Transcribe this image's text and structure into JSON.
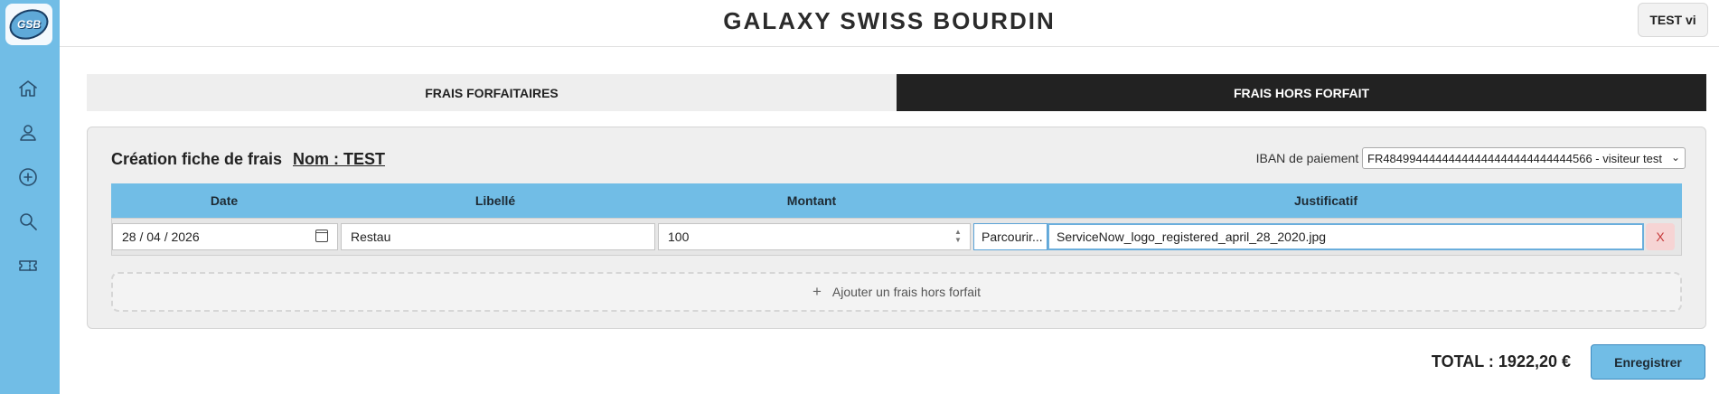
{
  "sidebar": {
    "logo_text": "GSB",
    "items": [
      {
        "icon": "home-icon"
      },
      {
        "icon": "user-icon"
      },
      {
        "icon": "add-circle-icon"
      },
      {
        "icon": "search-icon"
      },
      {
        "icon": "ticket-icon"
      }
    ]
  },
  "header": {
    "title": "GALAXY SWISS BOURDIN",
    "user_label": "TEST vi"
  },
  "tabs": [
    {
      "label": "FRAIS FORFAITAIRES",
      "active": false
    },
    {
      "label": "FRAIS HORS FORFAIT",
      "active": true
    }
  ],
  "form": {
    "title": "Création fiche de frais",
    "name_label": "Nom : TEST",
    "iban_label": "IBAN de paiement :",
    "iban_value": "FR48499444444444444444444444444566 - visiteur test"
  },
  "table": {
    "columns": [
      "Date",
      "Libellé",
      "Montant",
      "Justificatif"
    ],
    "rows": [
      {
        "date": "28 / 04 / 2026",
        "libelle": "Restau",
        "montant": "100",
        "browse_label": "Parcourir...",
        "file_name": "ServiceNow_logo_registered_april_28_2020.jpg",
        "delete_label": "X"
      }
    ]
  },
  "add_row_label": "Ajouter un frais hors forfait",
  "total_label": "TOTAL : 1922,20 €",
  "save_label": "Enregistrer",
  "colors": {
    "accent": "#71bde6",
    "tab_active_bg": "#222222",
    "delete_text": "#c63a3a"
  }
}
